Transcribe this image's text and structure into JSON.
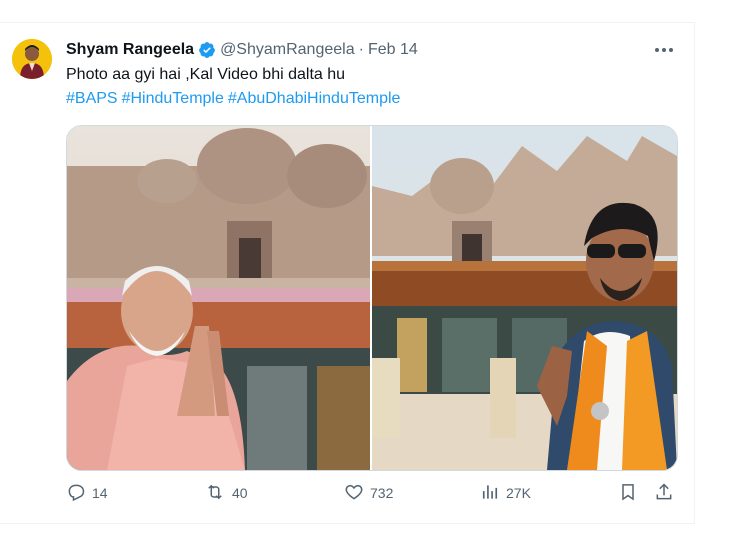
{
  "tweet": {
    "display_name": "Shyam Rangeela",
    "handle": "@ShyamRangeela",
    "separator": "·",
    "date": "Feb 14",
    "text": "Photo aa gyi hai ,Kal Video bhi dalta hu",
    "hashtags": [
      "#BAPS",
      "#HinduTemple",
      "#AbuDhabiHinduTemple"
    ],
    "accent_color": "#1d9bf0"
  },
  "actions": {
    "replies": "14",
    "reposts": "40",
    "likes": "732",
    "views": "27K"
  },
  "icons": {
    "verified": "verified-badge-icon",
    "more": "more-dots-icon",
    "reply": "reply-icon",
    "repost": "repost-icon",
    "like": "heart-icon",
    "views": "views-chart-icon",
    "bookmark": "bookmark-icon",
    "share": "share-icon"
  }
}
